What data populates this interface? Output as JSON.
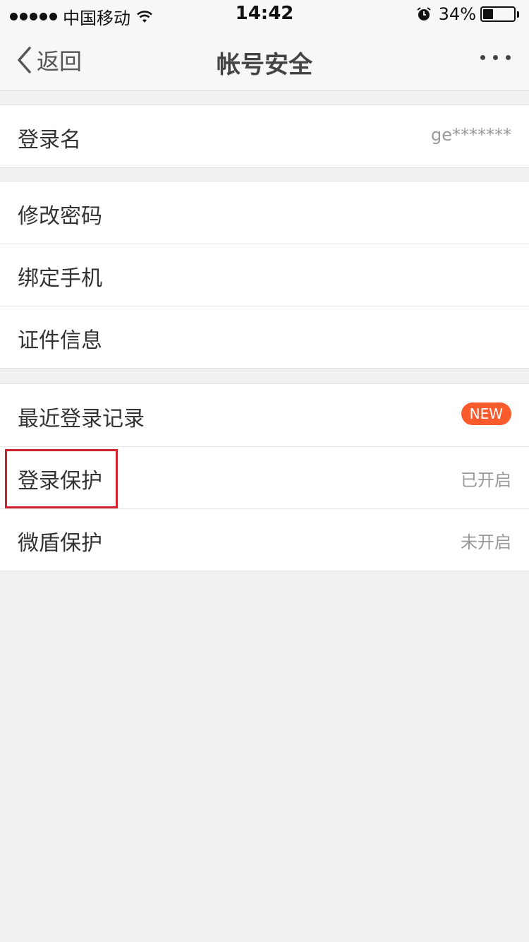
{
  "status_bar": {
    "carrier": "中国移动",
    "time": "14:42",
    "battery_percent": "34%",
    "battery_level": 0.34
  },
  "navbar": {
    "back_label": "返回",
    "title": "帐号安全"
  },
  "groups": [
    {
      "rows": [
        {
          "label": "登录名",
          "value": "ge*******"
        }
      ]
    },
    {
      "rows": [
        {
          "label": "修改密码"
        },
        {
          "label": "绑定手机"
        },
        {
          "label": "证件信息"
        }
      ]
    },
    {
      "rows": [
        {
          "label": "最近登录记录",
          "badge": "NEW"
        },
        {
          "label": "登录保护",
          "value": "已开启"
        },
        {
          "label": "微盾保护",
          "value": "未开启"
        }
      ]
    }
  ],
  "colors": {
    "badge": "#fb5a2d",
    "highlight": "#d0222c"
  }
}
